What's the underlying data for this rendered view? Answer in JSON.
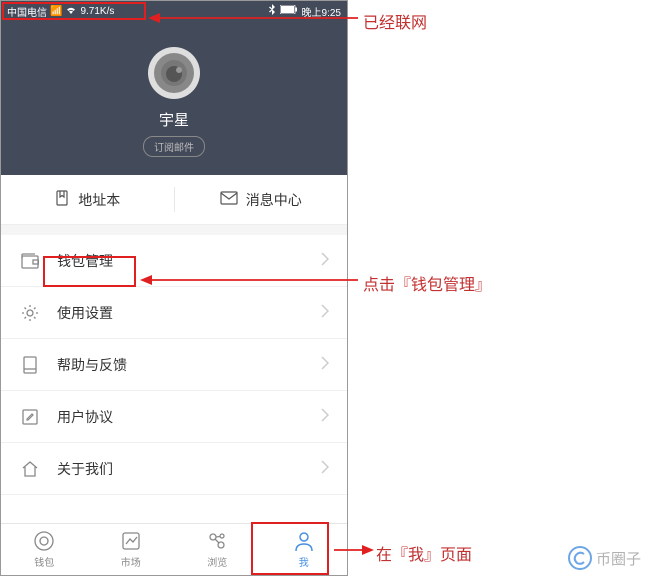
{
  "status_bar": {
    "carrier": "中国电信",
    "speed": "9.71K/s",
    "time": "晚上9:25"
  },
  "profile": {
    "username": "宇星",
    "subscribe_label": "订阅邮件"
  },
  "two_col": {
    "address_book": "地址本",
    "message_center": "消息中心"
  },
  "menu": {
    "wallet_mgmt": "钱包管理",
    "settings": "使用设置",
    "help": "帮助与反馈",
    "agreement": "用户协议",
    "about": "关于我们"
  },
  "nav": {
    "wallet": "钱包",
    "market": "市场",
    "browse": "浏览",
    "me": "我"
  },
  "annotations": {
    "connected": "已经联网",
    "click_wallet": "点击『钱包管理』",
    "on_me_page": "在『我』页面"
  },
  "watermark": {
    "text": "币圈子"
  }
}
